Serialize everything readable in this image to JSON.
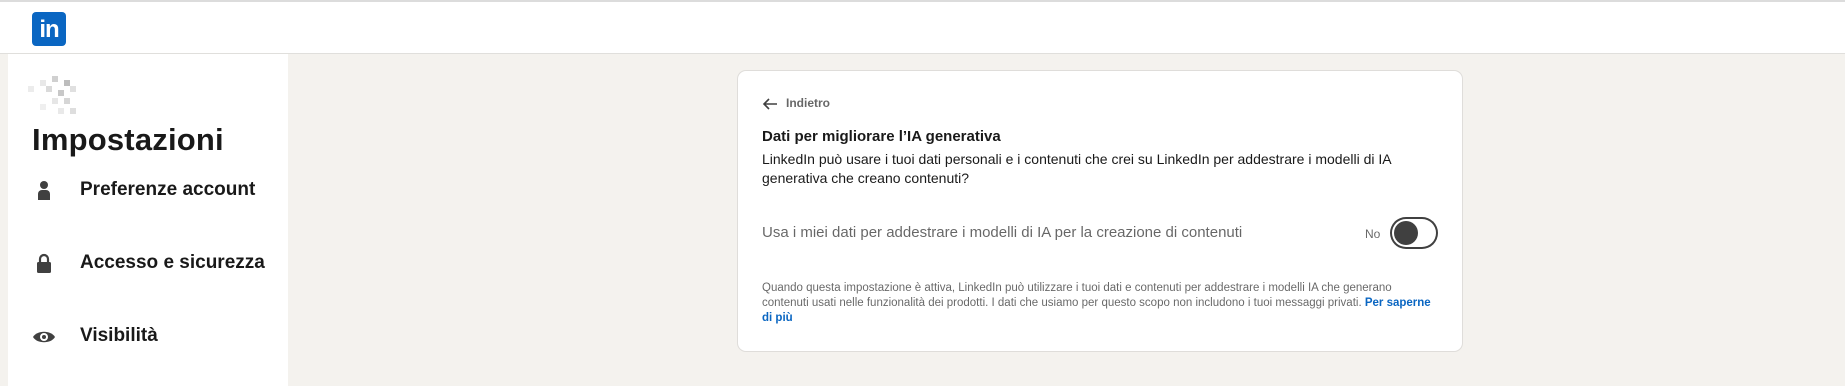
{
  "header": {
    "logo_text": "in",
    "logo_color": "#0a66c2"
  },
  "sidebar": {
    "title": "Impostazioni",
    "items": [
      {
        "label": "Preferenze account",
        "icon": "person-icon"
      },
      {
        "label": "Accesso e sicurezza",
        "icon": "lock-icon"
      },
      {
        "label": "Visibilità",
        "icon": "eye-icon"
      }
    ]
  },
  "card": {
    "back_label": "Indietro",
    "title": "Dati per migliorare l’IA generativa",
    "description": "LinkedIn può usare i tuoi dati personali e i contenuti che crei su LinkedIn per addestrare i modelli di IA generativa che creano contenuti?",
    "toggle": {
      "label": "Usa i miei dati per addestrare i modelli di IA per la creazione di contenuti",
      "state_label": "No",
      "on": false
    },
    "note": "Quando questa impostazione è attiva, LinkedIn può utilizzare i tuoi dati e contenuti per addestrare i modelli IA che generano contenuti usati nelle funzionalità dei prodotti. I dati che usiamo per questo scopo non includono i tuoi messaggi privati.",
    "learn_more": "Per saperne di più"
  }
}
